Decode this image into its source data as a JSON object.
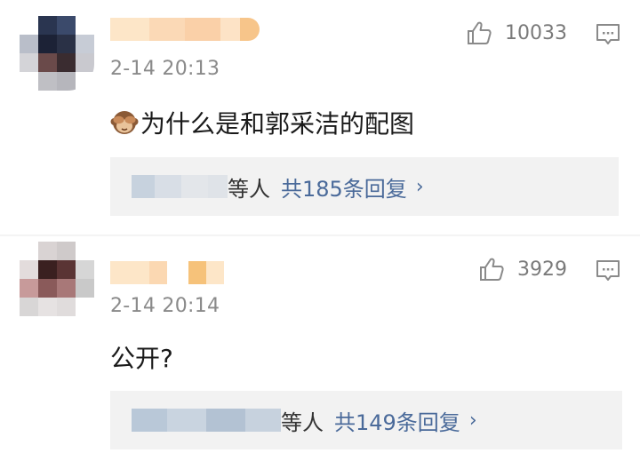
{
  "comments": [
    {
      "time": "2-14 20:13",
      "likes": "10033",
      "text": "为什么是和郭采洁的配图",
      "emoji": "see-no-evil-monkey",
      "replies": {
        "suffix": "等人",
        "count_label": "共185条回复",
        "arrow": "›"
      }
    },
    {
      "time": "2-14 20:14",
      "likes": "3929",
      "text": "公开?",
      "replies": {
        "suffix": "等人",
        "count_label": "共149条回复",
        "arrow": "›"
      }
    }
  ],
  "icons": {
    "like": "thumbs-up-icon",
    "reply": "comment-bubble-icon",
    "arrow": "chevron-right-icon"
  },
  "colors": {
    "link": "#4a6a9a",
    "muted": "#8a8a8a",
    "reply_bg": "#f2f2f2"
  }
}
